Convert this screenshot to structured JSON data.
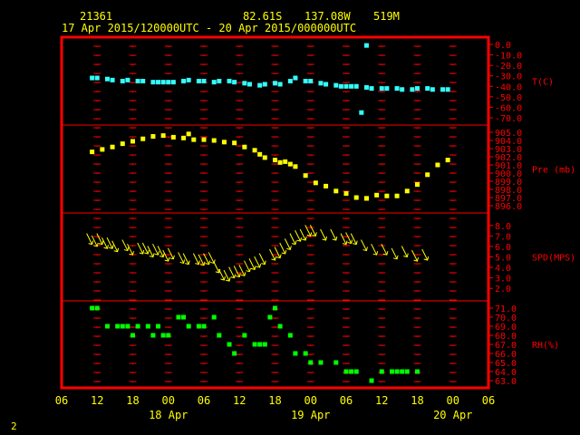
{
  "header": {
    "station": "21361",
    "lat": "82.61S",
    "lon": "137.08W",
    "elev": "519M",
    "time_range": "17 Apr 2015/120000UTC - 20 Apr 2015/000000UTC"
  },
  "footer": {
    "page": "2"
  },
  "colors": {
    "frame": "#ff0000",
    "text": "#ffff00",
    "temp": "#33ffff",
    "pres": "#ffff00",
    "wind": "#ffff00",
    "rh": "#00ff00"
  },
  "chart_data": {
    "type": "scatter",
    "x_axis": {
      "unit": "hour",
      "range": [
        -6,
        78
      ],
      "tick_labels": [
        "06",
        "12",
        "18",
        "00",
        "06",
        "12",
        "18",
        "00",
        "06",
        "12",
        "18",
        "00",
        "06"
      ],
      "date_labels": [
        "18 Apr",
        "19 Apr",
        "20 Apr"
      ]
    },
    "panels": [
      {
        "name": "T(C)",
        "ylim": [
          -70,
          0
        ],
        "ticks": [
          "0.0",
          "-10.0",
          "-20.0",
          "-30.0",
          "-40.0",
          "-50.0",
          "-60.0",
          "-70.0"
        ],
        "tick_values": [
          0,
          -10,
          -20,
          -30,
          -40,
          -50,
          -60,
          -70
        ],
        "x": [
          0,
          1,
          3,
          4,
          6,
          7,
          9,
          10,
          12,
          13,
          14,
          15,
          16,
          18,
          19,
          21,
          22,
          24,
          25,
          27,
          28,
          30,
          31,
          33,
          34,
          36,
          37,
          39,
          40,
          42,
          43,
          45,
          46,
          48,
          49,
          50,
          51,
          52,
          54,
          55,
          57,
          58,
          60,
          61,
          63,
          64,
          66,
          67,
          69,
          70
        ],
        "y": [
          -32,
          -32,
          -33,
          -34,
          -35,
          -34,
          -35,
          -35,
          -36,
          -36,
          -36,
          -36,
          -36,
          -35,
          -34,
          -35,
          -35,
          -36,
          -35,
          -35,
          -36,
          -37,
          -38,
          -39,
          -38,
          -37,
          -38,
          -35,
          -32,
          -35,
          -35,
          -37,
          -38,
          -39,
          -40,
          -40,
          -40,
          -40,
          -41,
          -42,
          -42,
          -42,
          -42,
          -43,
          -43,
          -42,
          -42,
          -43,
          -43,
          -43
        ],
        "outliers_x": [
          54,
          53
        ],
        "outliers_y": [
          -1,
          -65
        ]
      },
      {
        "name": "Pre (mb)",
        "ylim": [
          896,
          905
        ],
        "ticks": [
          "905.0",
          "904.0",
          "903.0",
          "902.0",
          "901.0",
          "900.0",
          "899.0",
          "898.0",
          "897.0",
          "896.0"
        ],
        "tick_values": [
          905,
          904,
          903,
          902,
          901,
          900,
          899,
          898,
          897,
          896
        ],
        "x": [
          0,
          2,
          4,
          6,
          8,
          10,
          12,
          14,
          16,
          18,
          19,
          20,
          22,
          24,
          26,
          28,
          30,
          32,
          33,
          34,
          36,
          37,
          38,
          39,
          40,
          42,
          44,
          46,
          48,
          50,
          52,
          54,
          56,
          58,
          60,
          62,
          64,
          66,
          68
        ],
        "y": [
          902.6,
          902.9,
          903.2,
          903.6,
          903.9,
          904.2,
          904.5,
          904.6,
          904.4,
          904.3,
          904.8,
          904.1,
          904.1,
          904.0,
          903.8,
          903.7,
          903.2,
          902.8,
          902.3,
          901.9,
          901.6,
          901.3,
          901.4,
          901.1,
          900.8,
          899.7,
          898.8,
          898.4,
          897.8,
          897.5,
          897.0,
          896.9,
          897.3,
          897.2,
          897.2,
          897.8,
          898.6,
          899.8,
          901.0
        ],
        "extra_x": [
          70,
          54
        ],
        "extra_y": [
          901.6,
          896.9
        ]
      },
      {
        "name": "SPD(MPS)",
        "ylim": [
          1.5,
          8.5
        ],
        "ticks": [
          "8.0",
          "7.0",
          "6.0",
          "5.0",
          "4.0",
          "3.0",
          "2.0"
        ],
        "tick_values": [
          8,
          7,
          6,
          5,
          4,
          3,
          2
        ],
        "x": [
          0,
          1,
          2,
          3,
          4,
          5,
          7,
          8,
          10,
          11,
          12,
          13,
          14,
          15,
          16,
          18,
          19,
          21,
          22,
          23,
          24,
          25,
          26,
          27,
          28,
          29,
          30,
          31,
          32,
          33,
          34,
          36,
          37,
          38,
          39,
          40,
          41,
          42,
          43,
          44,
          46,
          48,
          50,
          51,
          52,
          54,
          56,
          58,
          60,
          62,
          64,
          66
        ],
        "y": [
          6.2,
          6.0,
          6.2,
          5.8,
          5.8,
          5.5,
          5.6,
          5.2,
          5.3,
          5.3,
          5.0,
          5.2,
          5.0,
          4.6,
          4.8,
          4.4,
          4.3,
          4.3,
          4.2,
          4.3,
          4.4,
          3.5,
          2.8,
          2.7,
          3.0,
          3.1,
          3.2,
          3.6,
          3.8,
          4.0,
          4.3,
          4.7,
          4.9,
          5.3,
          5.7,
          6.2,
          6.5,
          6.6,
          7.0,
          7.0,
          6.6,
          6.6,
          6.2,
          6.3,
          6.2,
          5.6,
          5.2,
          5.2,
          4.8,
          5.0,
          4.6,
          4.7
        ]
      },
      {
        "name": "RH(%)",
        "ylim": [
          63,
          71
        ],
        "ticks": [
          "71.0",
          "70.0",
          "69.0",
          "68.0",
          "67.0",
          "66.0",
          "65.0",
          "64.0",
          "63.0"
        ],
        "tick_values": [
          71,
          70,
          69,
          68,
          67,
          66,
          65,
          64,
          63
        ],
        "x": [
          0,
          1,
          3,
          5,
          6,
          7,
          8,
          9,
          11,
          12,
          13,
          14,
          15,
          17,
          18,
          19,
          21,
          22,
          24,
          25,
          27,
          28,
          30,
          32,
          33,
          34,
          35,
          36,
          37,
          39,
          40,
          42,
          43,
          45,
          48,
          50,
          51,
          52,
          55,
          57,
          59,
          60,
          61,
          62,
          64
        ],
        "y": [
          71.0,
          71.0,
          69.0,
          69.0,
          69.0,
          69.0,
          68.0,
          69.0,
          69.0,
          68.0,
          69.0,
          68.0,
          68.0,
          70.0,
          70.0,
          69.0,
          69.0,
          69.0,
          70.0,
          68.0,
          67.0,
          66.0,
          68.0,
          67.0,
          67.0,
          67.0,
          70.0,
          71.0,
          69.0,
          68.0,
          66.0,
          66.0,
          65.0,
          65.0,
          65.0,
          64.0,
          64.0,
          64.0,
          63.0,
          64.0,
          64.0,
          64.0,
          64.0,
          64.0,
          64.0
        ]
      }
    ]
  }
}
